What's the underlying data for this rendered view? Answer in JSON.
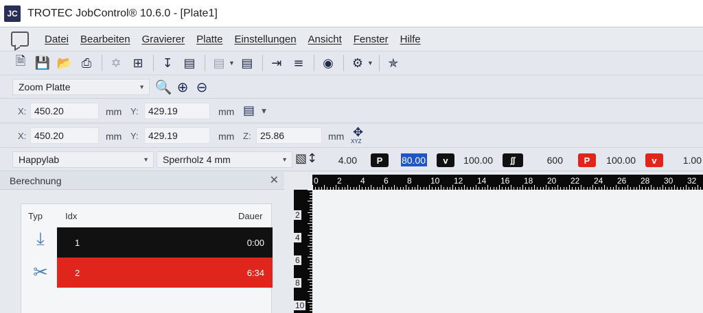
{
  "window": {
    "logo": "JC",
    "title": "TROTEC JobControl® 10.6.0 - [Plate1]"
  },
  "menu": {
    "items": [
      "Datei",
      "Bearbeiten",
      "Gravierer",
      "Platte",
      "Einstellungen",
      "Ansicht",
      "Fenster",
      "Hilfe"
    ]
  },
  "toolbar": {
    "icons": [
      "new-file-icon",
      "save-icon",
      "open-icon",
      "print-icon",
      "crosshair-icon",
      "align-icon",
      "download-job-icon",
      "export-icon",
      "plate-menu-icon",
      "stack-icon",
      "import-icon",
      "list-icon",
      "eye-icon",
      "settings-gear-icon",
      "laser-icon"
    ]
  },
  "zoom": {
    "selected": "Zoom Platte"
  },
  "cursor_pos": {
    "x_label": "X:",
    "x": "450.20",
    "y_label": "Y:",
    "y": "429.19",
    "unit": "mm"
  },
  "plate_pos": {
    "x_label": "X:",
    "x": "450.20",
    "y_label": "Y:",
    "y": "429.19",
    "z_label": "Z:",
    "z": "25.86",
    "unit": "mm",
    "xyz_label": "XYZ"
  },
  "material": {
    "profile": "Happylab",
    "material": "Sperrholz 4 mm",
    "thickness": "4.00",
    "engrave_power_label": "P",
    "engrave_power": "80.00",
    "engrave_speed_label": "v",
    "engrave_speed": "100.00",
    "ppi": "600",
    "cut_power_label": "P",
    "cut_power": "100.00",
    "cut_speed_label": "v",
    "cut_speed": "1.00",
    "colors": {
      "engrave": "#111111",
      "cut": "#e0261c"
    }
  },
  "calc_panel": {
    "title": "Berechnung",
    "close": "✕",
    "headers": {
      "typ": "Typ",
      "idx": "Idx",
      "dauer": "Dauer"
    },
    "rows": [
      {
        "idx": "1",
        "dauer": "0:00",
        "color": "#111111",
        "type": "engrave-icon"
      },
      {
        "idx": "2",
        "dauer": "6:34",
        "color": "#e0261c",
        "type": "scissors-icon"
      }
    ]
  },
  "ruler": {
    "top_ticks": [
      "0",
      "2",
      "4",
      "6",
      "8",
      "10",
      "12",
      "14",
      "16",
      "18",
      "20",
      "22",
      "24",
      "26",
      "28",
      "30",
      "32"
    ],
    "left_ticks": [
      "2",
      "4",
      "6",
      "8",
      "10"
    ]
  }
}
